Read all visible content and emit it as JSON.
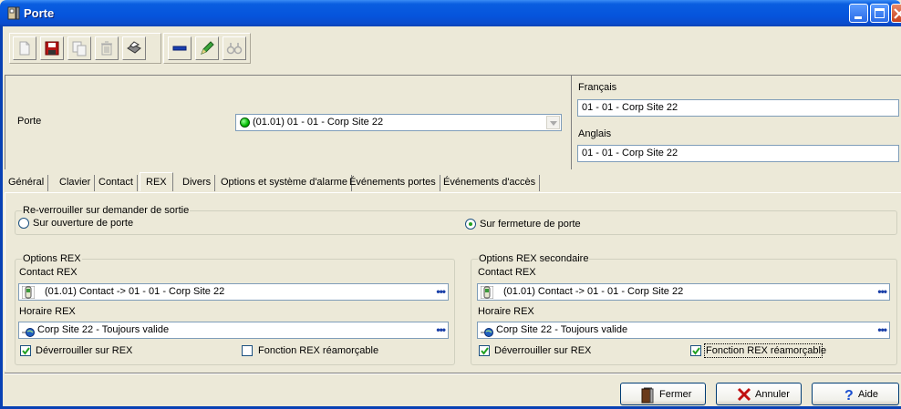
{
  "window": {
    "title": "Porte"
  },
  "toolbar": {
    "buttons": [
      "new-icon",
      "save-icon",
      "copy-icon",
      "delete-icon",
      "print-icon",
      "link-icon",
      "edit-icon",
      "find-icon"
    ]
  },
  "door": {
    "label": "Porte",
    "selected_value": "(01.01) 01 - 01 - Corp Site 22",
    "status_color": "#00bb00"
  },
  "languages": {
    "french_label": "Français",
    "french_value": "01 - 01 - Corp Site 22",
    "english_label": "Anglais",
    "english_value": "01 - 01 - Corp Site 22"
  },
  "tabs": [
    {
      "label": "Général"
    },
    {
      "label": "Clavier"
    },
    {
      "label": "Contact"
    },
    {
      "label": "REX",
      "active": true
    },
    {
      "label": "Divers"
    },
    {
      "label": "Options et système d'alarme"
    },
    {
      "label": "Événements portes"
    },
    {
      "label": "Événements d'accès"
    }
  ],
  "relock": {
    "legend": "Re-verrouiller sur demander de sortie",
    "opt_open": "Sur ouverture de porte",
    "opt_close": "Sur fermeture de porte",
    "selected": "close"
  },
  "rex": {
    "legend": "Options REX",
    "contact_label": "Contact REX",
    "contact_value": "(01.01) Contact -> 01 - 01 - Corp Site 22",
    "schedule_label": "Horaire REX",
    "schedule_value": "Corp Site 22 - Toujours valide",
    "unlock_label": "Déverrouiller sur REX",
    "unlock_checked": true,
    "rearm_label": "Fonction REX réamorçable",
    "rearm_checked": false
  },
  "rex2": {
    "legend": "Options REX secondaire",
    "contact_label": "Contact REX",
    "contact_value": "(01.01) Contact -> 01 - 01 - Corp Site 22",
    "schedule_label": "Horaire REX",
    "schedule_value": "Corp Site 22 - Toujours valide",
    "unlock_label": "Déverrouiller sur REX",
    "unlock_checked": true,
    "rearm_label": "Fonction REX réamorçable",
    "rearm_checked": true
  },
  "actions": {
    "close": "Fermer",
    "cancel": "Annuler",
    "help": "Aide"
  }
}
